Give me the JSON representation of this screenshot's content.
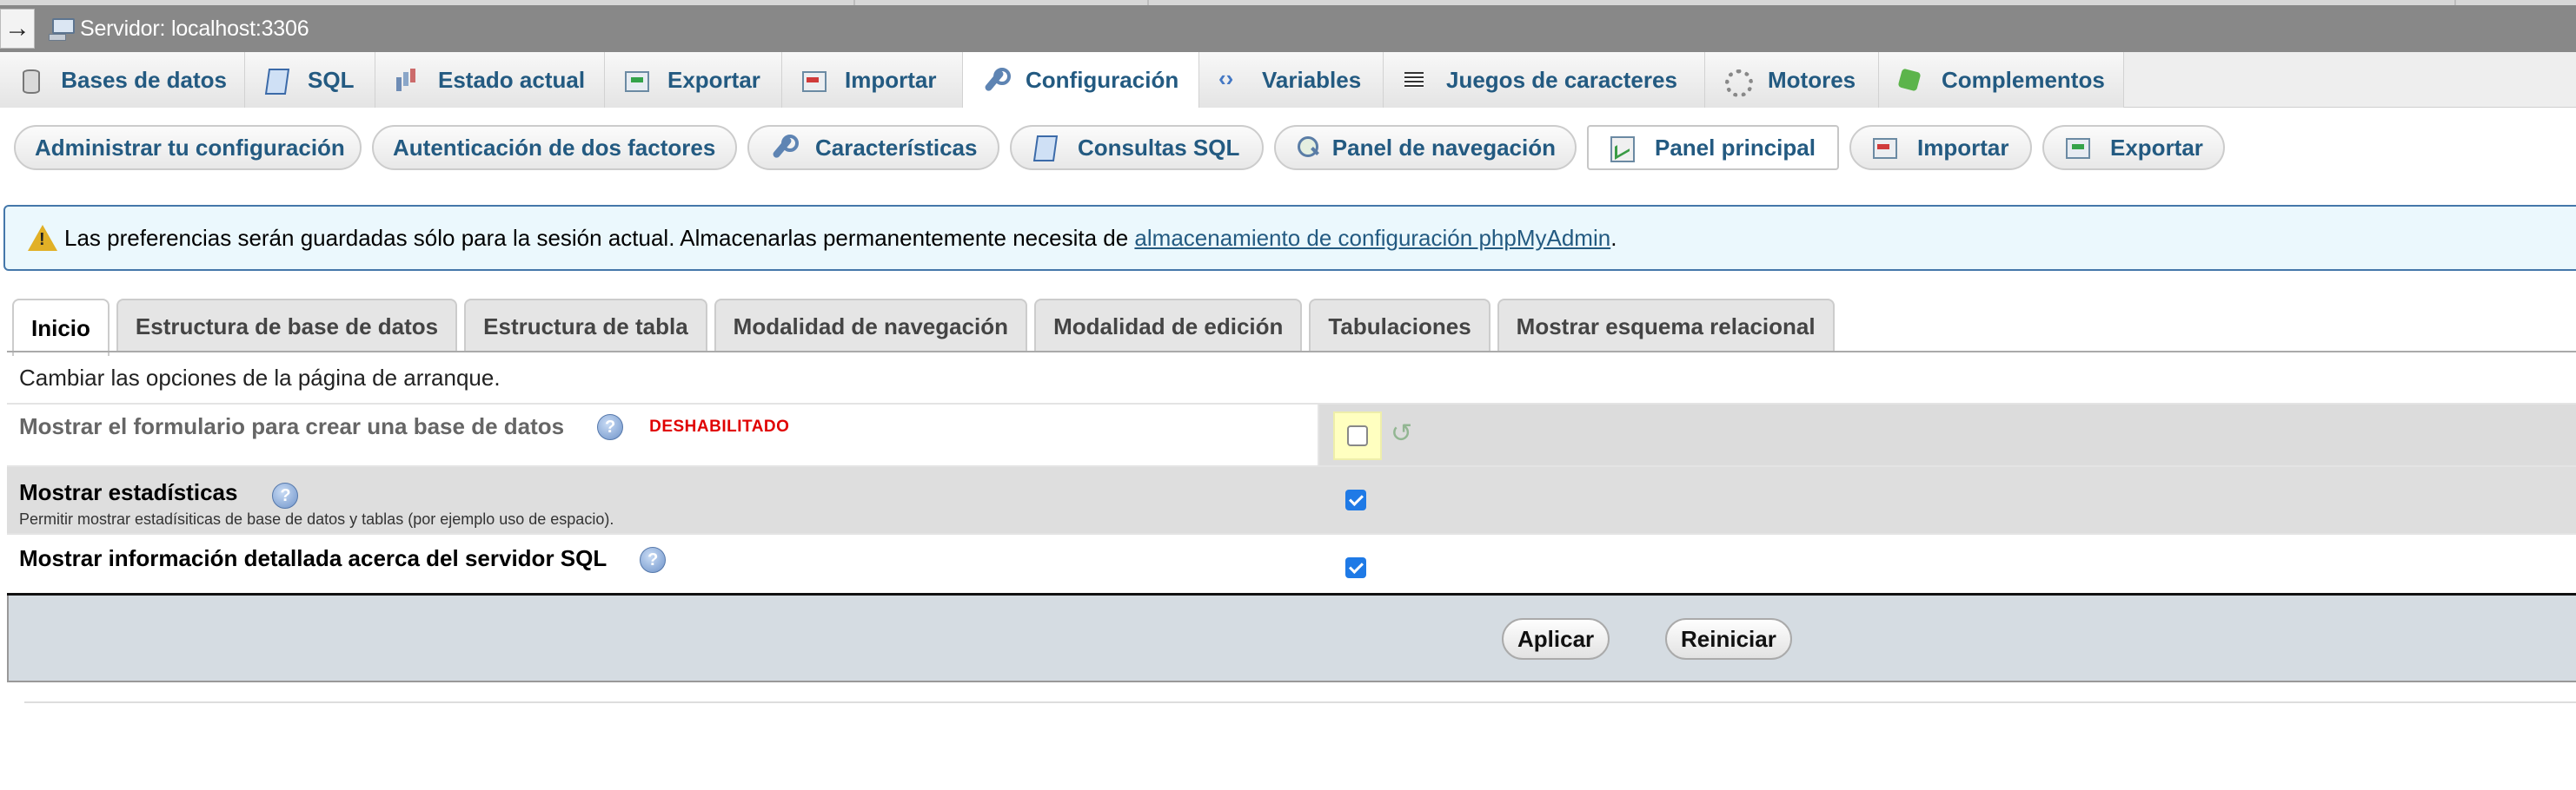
{
  "server": {
    "collapse_glyph": "→",
    "label": "Servidor: localhost:3306"
  },
  "main_tabs": [
    {
      "label": "Bases de datos",
      "icon": "database-icon"
    },
    {
      "label": "SQL",
      "icon": "sql-icon"
    },
    {
      "label": "Estado actual",
      "icon": "status-chart-icon"
    },
    {
      "label": "Exportar",
      "icon": "export-icon"
    },
    {
      "label": "Importar",
      "icon": "import-icon"
    },
    {
      "label": "Configuración",
      "icon": "wrench-icon",
      "active": true
    },
    {
      "label": "Variables",
      "icon": "variables-icon"
    },
    {
      "label": "Juegos de caracteres",
      "icon": "charset-icon"
    },
    {
      "label": "Motores",
      "icon": "engines-icon"
    },
    {
      "label": "Complementos",
      "icon": "plugins-icon"
    }
  ],
  "sub_nav": [
    {
      "label": "Administrar tu configuración"
    },
    {
      "label": "Autenticación de dos factores"
    },
    {
      "label": "Características",
      "icon": "wrench-icon"
    },
    {
      "label": "Consultas SQL",
      "icon": "sql-icon"
    },
    {
      "label": "Panel de navegación",
      "icon": "navigation-icon"
    },
    {
      "label": "Panel principal",
      "icon": "main-panel-icon",
      "active": true
    },
    {
      "label": "Importar",
      "icon": "import-icon"
    },
    {
      "label": "Exportar",
      "icon": "export-icon"
    }
  ],
  "notice": {
    "text": "Las preferencias serán guardadas sólo para la sesión actual. Almacenarlas permanentemente necesita de ",
    "link": "almacenamiento de configuración phpMyAdmin",
    "suffix": "."
  },
  "settings_tabs": [
    {
      "label": "Inicio",
      "active": true
    },
    {
      "label": "Estructura de base de datos"
    },
    {
      "label": "Estructura de tabla"
    },
    {
      "label": "Modalidad de navegación"
    },
    {
      "label": "Modalidad de edición"
    },
    {
      "label": "Tabulaciones"
    },
    {
      "label": "Mostrar esquema relacional"
    }
  ],
  "form": {
    "description": "Cambiar las opciones de la página de arranque.",
    "rows": [
      {
        "label": "Mostrar el formulario para crear una base de datos",
        "badge": "DESHABILITADO",
        "checked": false
      },
      {
        "label": "Mostrar estadísticas",
        "sublabel": "Permitir mostrar estadísiticas de base de datos y tablas (por ejemplo uso de espacio).",
        "checked": true
      },
      {
        "label": "Mostrar información detallada acerca del servidor SQL",
        "checked": true
      }
    ],
    "apply_label": "Aplicar",
    "reset_label": "Reiniciar"
  },
  "colors": {
    "link": "#235a81",
    "notice_bg": "#ebf8fd",
    "disabled_badge": "#e00000",
    "checkbox_on": "#1f7ae6"
  }
}
